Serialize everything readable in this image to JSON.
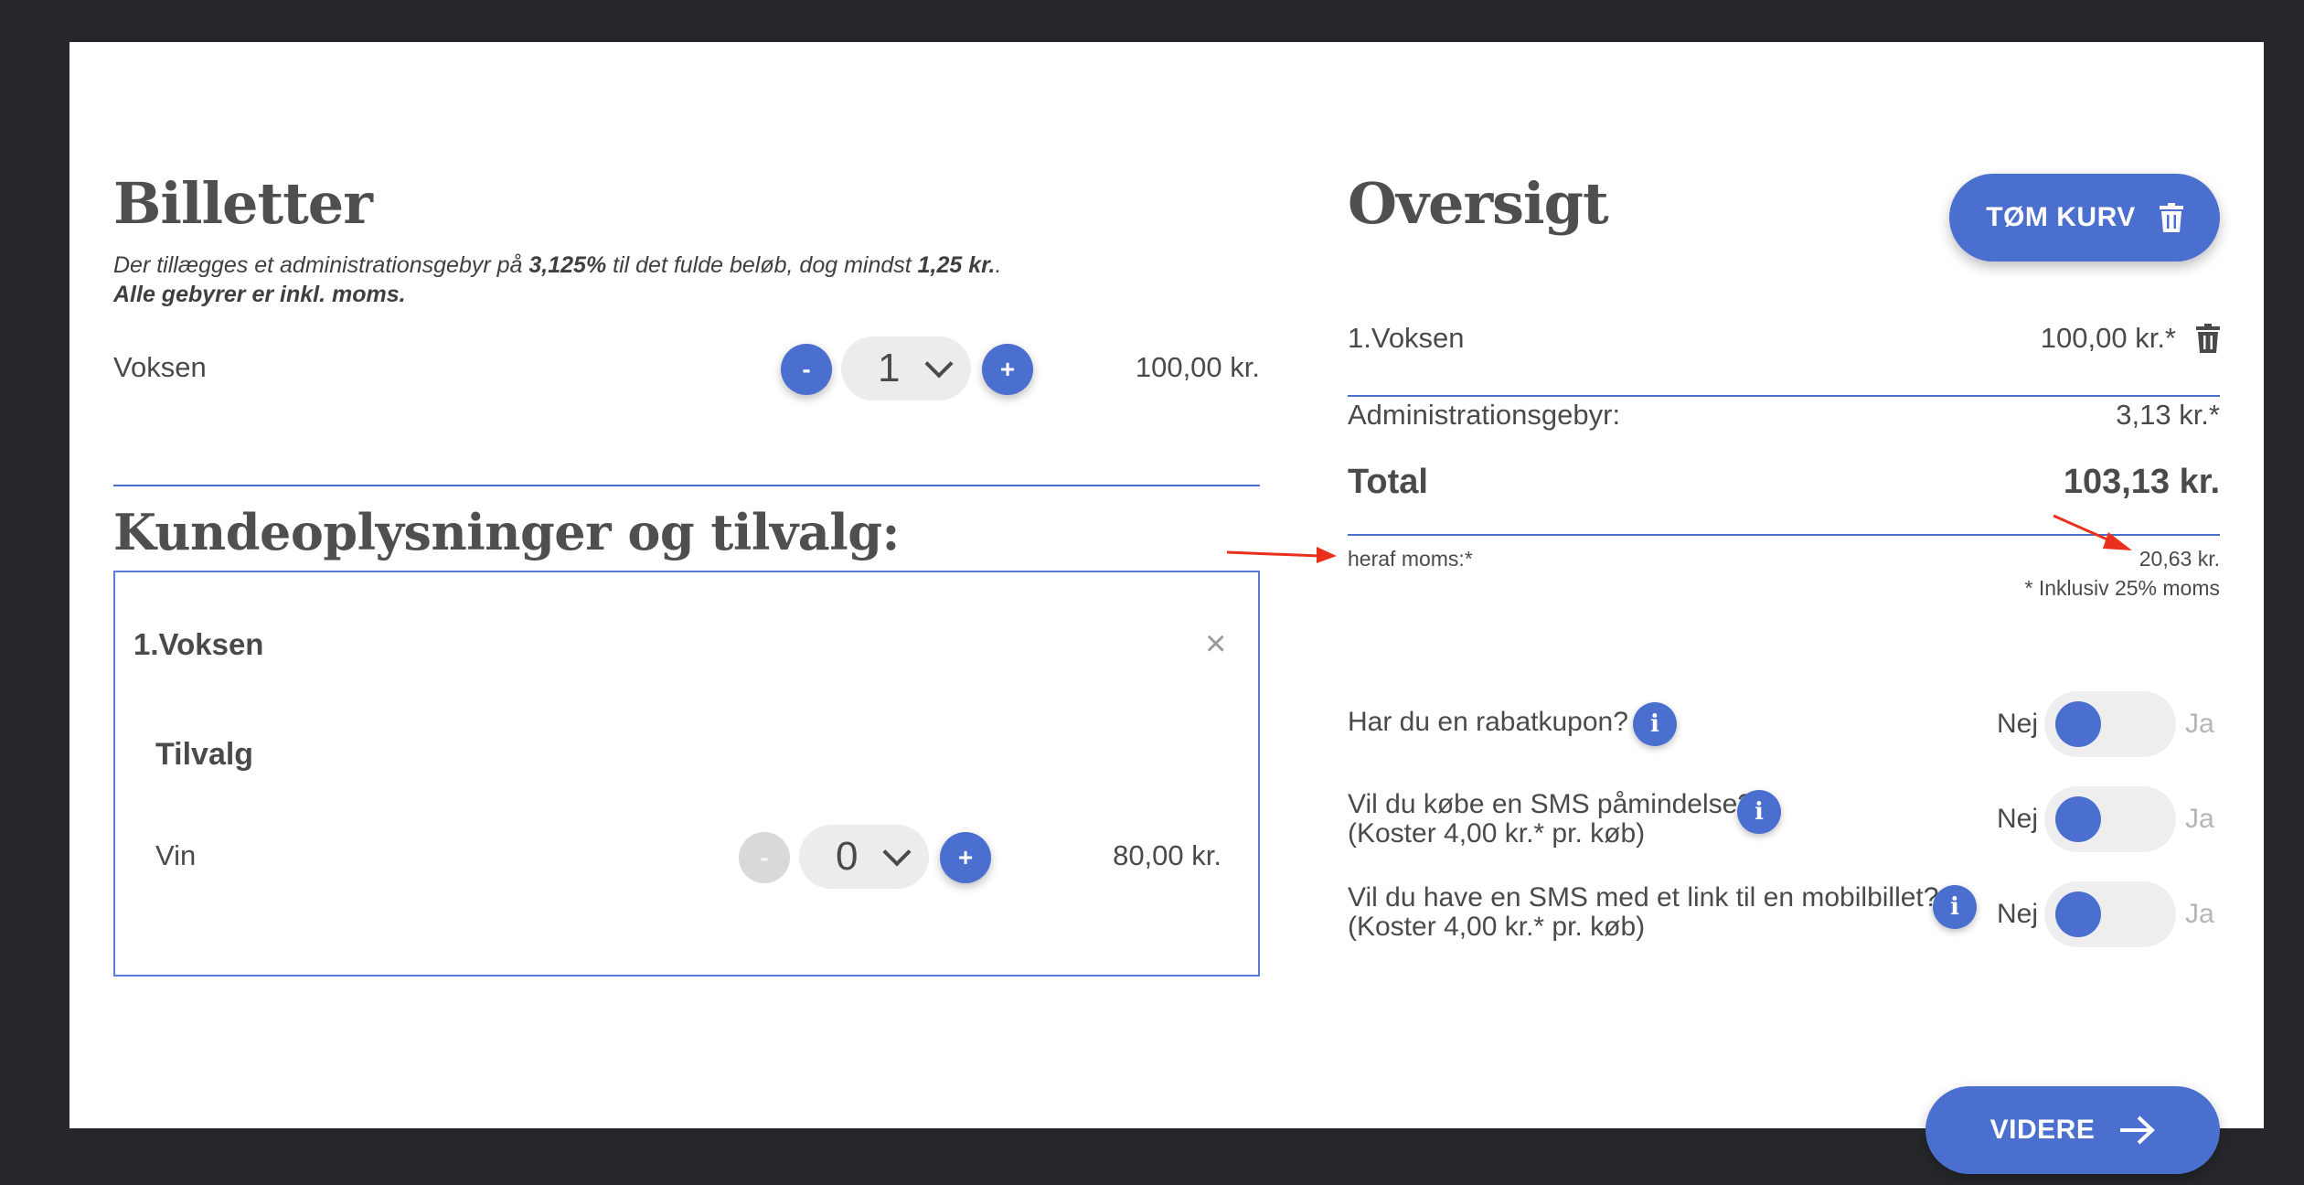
{
  "tickets": {
    "title": "Billetter",
    "fee_note": {
      "p1": "Der tillægges et administrationsgebyr på ",
      "rate": "3,125%",
      "p2": " til det fulde beløb, dog mindst ",
      "min": "1,25 kr.",
      "p3": ".",
      "line2": "Alle gebyrer er inkl. moms."
    },
    "items": [
      {
        "label": "Voksen",
        "minus": "-",
        "qty": "1",
        "plus": "+",
        "price": "100,00 kr."
      }
    ]
  },
  "customer": {
    "title": "Kundeoplysninger og tilvalg:",
    "box_title": "1.Voksen",
    "close": "×",
    "addons_title": "Tilvalg",
    "addons": [
      {
        "label": "Vin",
        "minus": "-",
        "qty": "0",
        "plus": "+",
        "price": "80,00 kr."
      }
    ]
  },
  "overview": {
    "title": "Oversigt",
    "clear_button": "TØM KURV",
    "line_item": {
      "label": "1.Voksen",
      "price": "100,00 kr.*"
    },
    "admin_fee": {
      "label": "Administrationsgebyr:",
      "value": "3,13 kr.*"
    },
    "total": {
      "label": "Total",
      "value": "103,13 kr."
    },
    "vat": {
      "label": "heraf moms:*",
      "value": "20,63 kr."
    },
    "vat_note": "* Inklusiv 25% moms"
  },
  "options": [
    {
      "line1": "Har du en rabatkupon?",
      "line2": "",
      "no": "Nej",
      "yes": "Ja",
      "on": false
    },
    {
      "line1": "Vil du købe en SMS påmindelse?",
      "line2": "(Koster 4,00 kr.* pr. køb)",
      "no": "Nej",
      "yes": "Ja",
      "on": false
    },
    {
      "line1": "Vil du have en SMS med et link til en mobilbillet?",
      "line2": "(Koster 4,00 kr.* pr. køb)",
      "no": "Nej",
      "yes": "Ja",
      "on": false
    }
  ],
  "next_button": "VIDERE",
  "colors": {
    "accent": "#4b6fcf",
    "annotation_arrow": "#e8301c",
    "backdrop": "#26272a"
  },
  "icons": [
    "trash-icon",
    "arrow-right-icon",
    "info-icon",
    "chevron-down-icon",
    "close-icon"
  ]
}
